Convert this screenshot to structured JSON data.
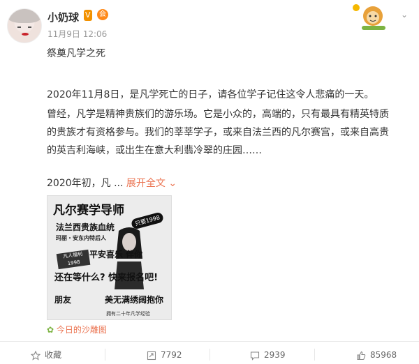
{
  "post": {
    "author": "小奶球",
    "verified_badge": "V",
    "badge2": "会",
    "time": "11月9日 12:06",
    "title": "祭奠凡学之死",
    "p1": "2020年11月8日，是凡学死亡的日子，请各位学子记住这令人悲痛的一天。",
    "p2_line1": "曾经，凡学是精神贵族们的游乐场。它是小众的，高端的，只有最具有精英特质",
    "p2_line2": "的贵族才有资格参与。我们的莘莘学子，或来自法兰西的凡尔赛宫，或来自高贵",
    "p2_line3": "的英吉利海峡，或出生在意大利翡冷翠的庄园……",
    "p3_prefix": "2020年初，凡 ... ",
    "expand_label": "展开全文",
    "source_label": "今日的沙雕图"
  },
  "poster": {
    "title": "凡尔赛学导师",
    "sub": "法兰西贵族血统",
    "small": "玛丽・安东内特后人",
    "badge": "只要1998",
    "mid": "平安喜乐 伴你",
    "sticker": "凡人福利 1998",
    "big": "还在等什么? 快来报名吧!",
    "friend": "朋友",
    "hug": "美无满绣阔抱你",
    "foot": "拥有二十年凡学经验"
  },
  "actions": {
    "collect": "收藏",
    "forward": "7792",
    "comment": "2939",
    "like": "85968"
  },
  "colors": {
    "accent": "#eb7350",
    "vip": "#f29100"
  }
}
